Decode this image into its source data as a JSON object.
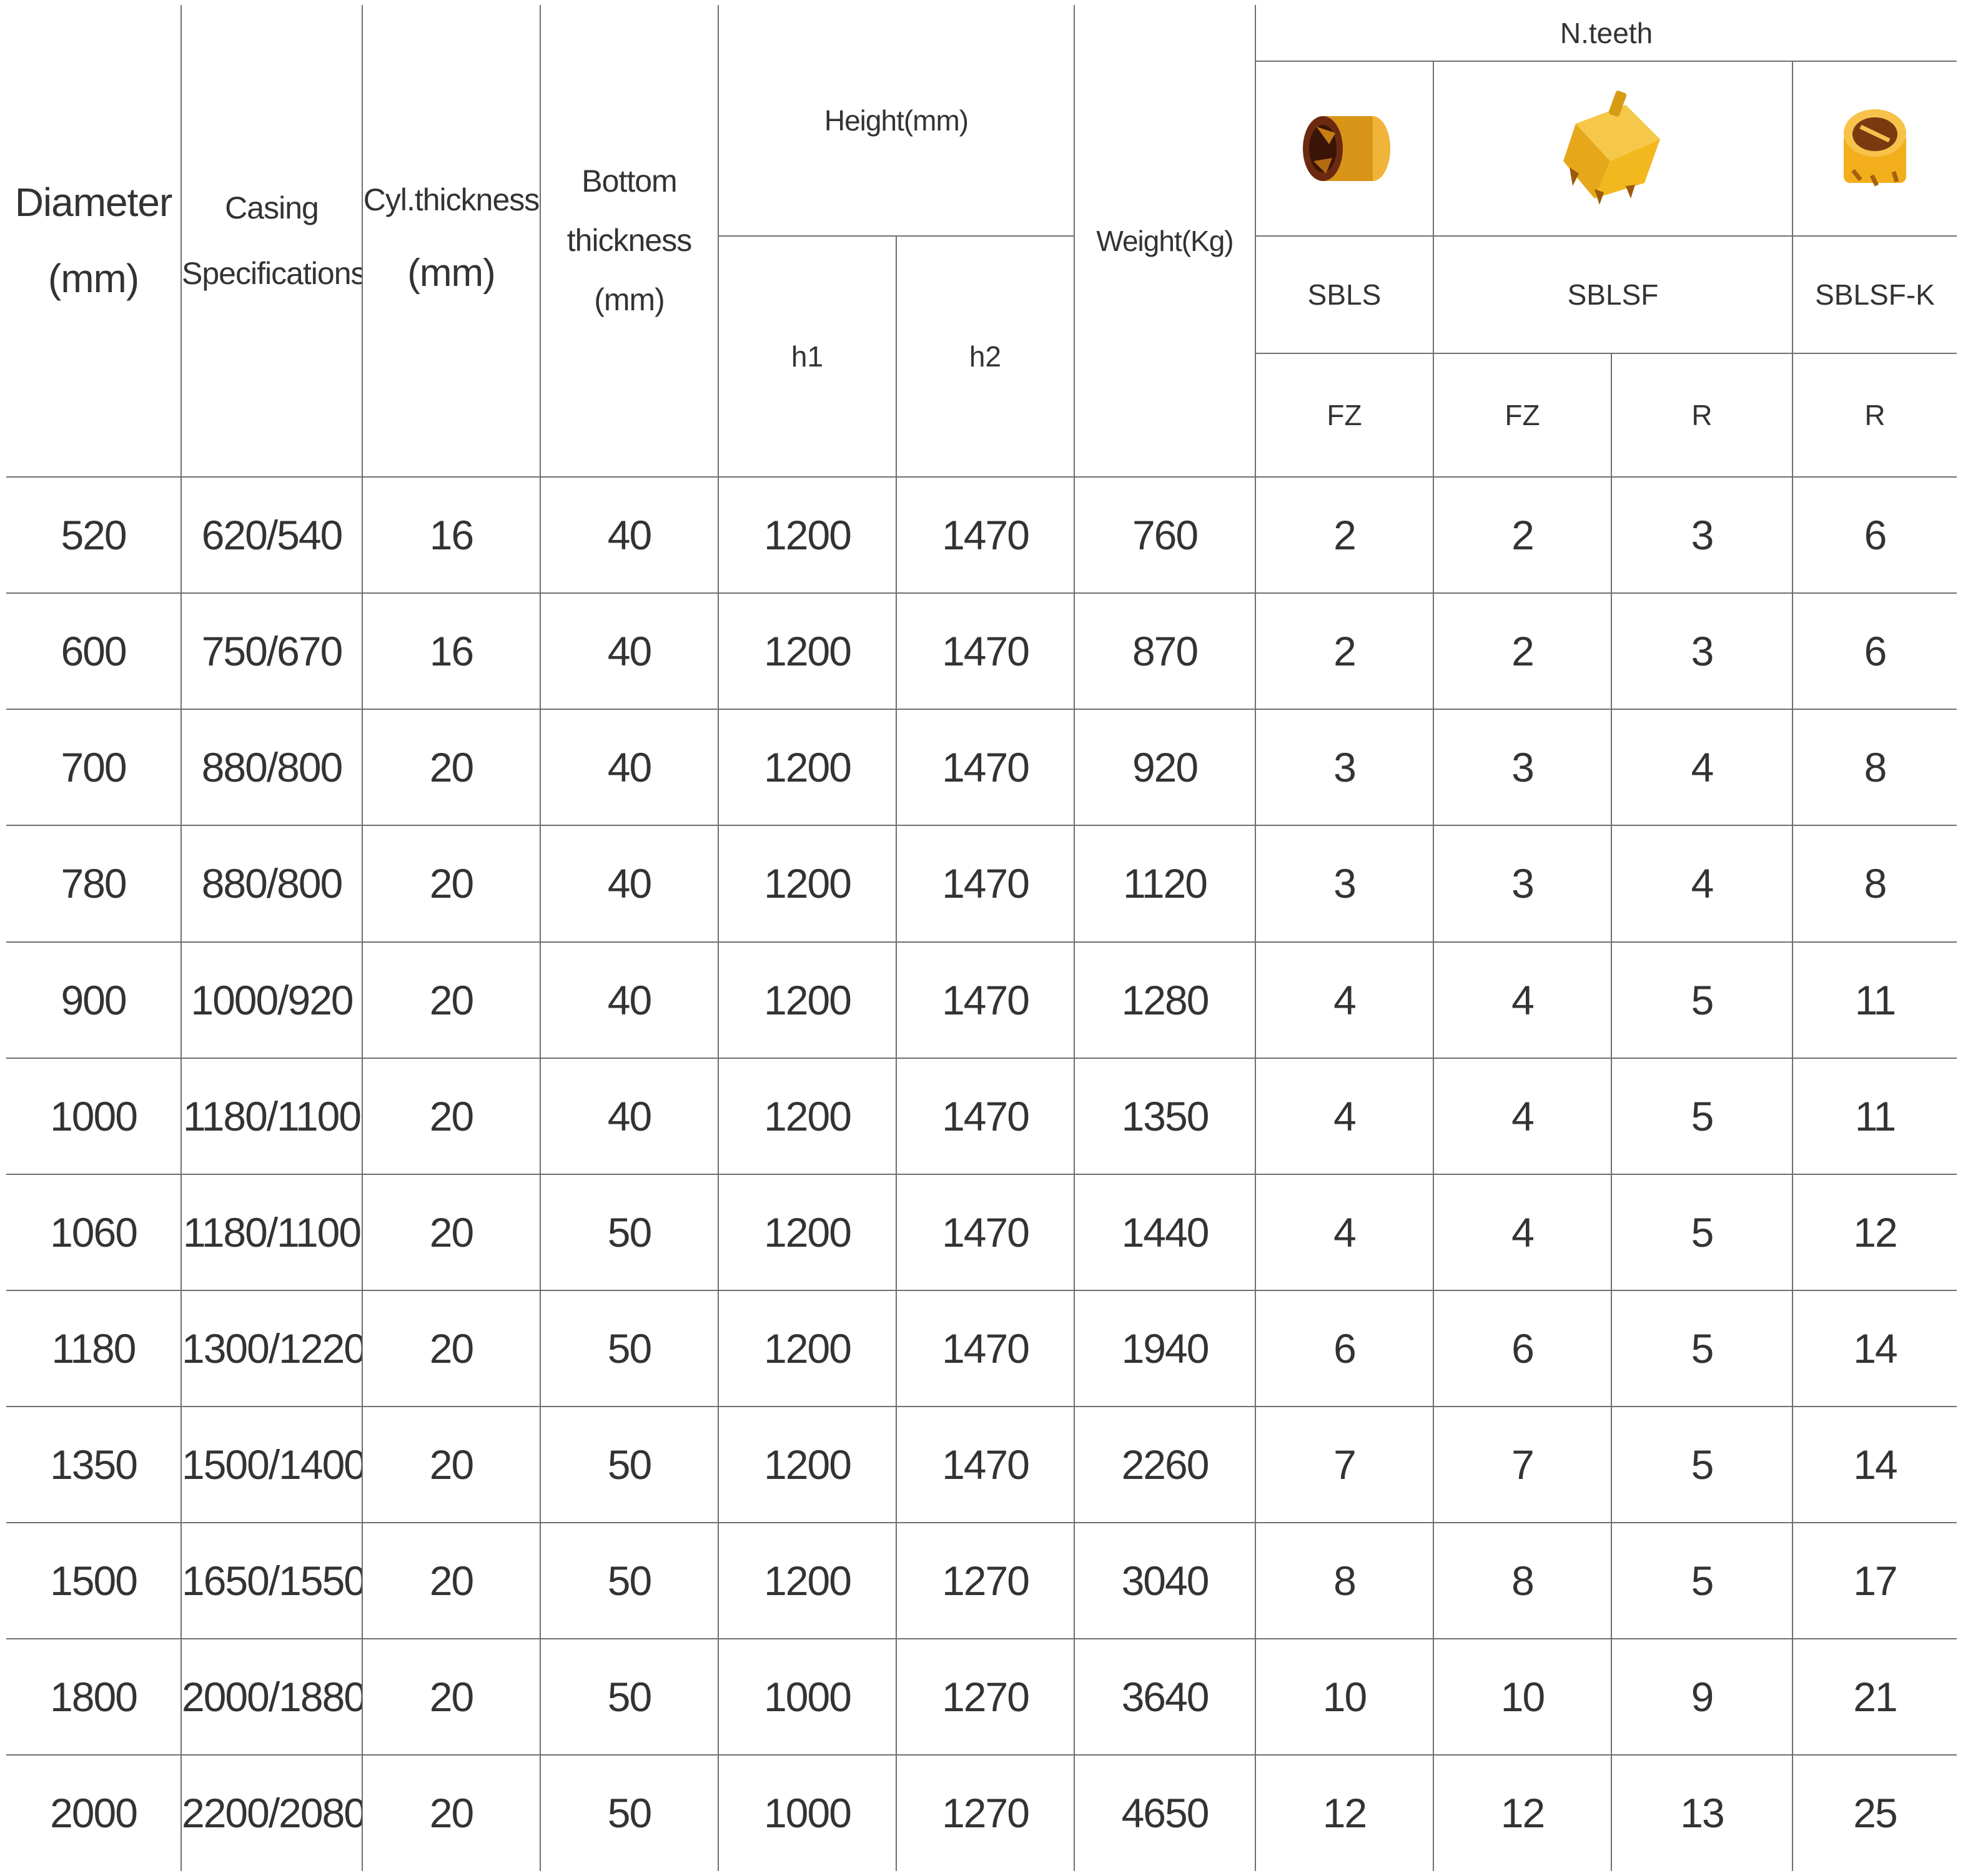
{
  "headers": {
    "diameter": [
      "Diameter",
      "(mm)"
    ],
    "casing": [
      "Casing",
      "Specifications"
    ],
    "cyl_thickness": [
      "Cyl.thickness",
      "(mm)"
    ],
    "bottom_thickness": [
      "Bottom",
      "thickness",
      "(mm)"
    ],
    "height": "Height(mm)",
    "h1": "h1",
    "h2": "h2",
    "weight": "Weight(Kg)",
    "n_teeth": "N.teeth",
    "models": [
      "SBLS",
      "SBLSF",
      "SBLSF-K"
    ],
    "teeth_types": [
      "FZ",
      "FZ",
      "R",
      "R"
    ]
  },
  "icons": [
    {
      "name": "sbls-bucket-icon",
      "color": "#e8a317"
    },
    {
      "name": "sblsf-bucket-icon",
      "color": "#f2b81e"
    },
    {
      "name": "sblsf-k-bucket-icon",
      "color": "#f5b521"
    }
  ],
  "rows": [
    [
      "520",
      "620/540",
      "16",
      "40",
      "1200",
      "1470",
      "760",
      "2",
      "2",
      "3",
      "6"
    ],
    [
      "600",
      "750/670",
      "16",
      "40",
      "1200",
      "1470",
      "870",
      "2",
      "2",
      "3",
      "6"
    ],
    [
      "700",
      "880/800",
      "20",
      "40",
      "1200",
      "1470",
      "920",
      "3",
      "3",
      "4",
      "8"
    ],
    [
      "780",
      "880/800",
      "20",
      "40",
      "1200",
      "1470",
      "1120",
      "3",
      "3",
      "4",
      "8"
    ],
    [
      "900",
      "1000/920",
      "20",
      "40",
      "1200",
      "1470",
      "1280",
      "4",
      "4",
      "5",
      "11"
    ],
    [
      "1000",
      "1180/1100",
      "20",
      "40",
      "1200",
      "1470",
      "1350",
      "4",
      "4",
      "5",
      "11"
    ],
    [
      "1060",
      "1180/1100",
      "20",
      "50",
      "1200",
      "1470",
      "1440",
      "4",
      "4",
      "5",
      "12"
    ],
    [
      "1180",
      "1300/1220",
      "20",
      "50",
      "1200",
      "1470",
      "1940",
      "6",
      "6",
      "5",
      "14"
    ],
    [
      "1350",
      "1500/1400",
      "20",
      "50",
      "1200",
      "1470",
      "2260",
      "7",
      "7",
      "5",
      "14"
    ],
    [
      "1500",
      "1650/1550",
      "20",
      "50",
      "1200",
      "1270",
      "3040",
      "8",
      "8",
      "5",
      "17"
    ],
    [
      "1800",
      "2000/1880",
      "20",
      "50",
      "1000",
      "1270",
      "3640",
      "10",
      "10",
      "9",
      "21"
    ],
    [
      "2000",
      "2200/2080",
      "20",
      "50",
      "1000",
      "1270",
      "4650",
      "12",
      "12",
      "13",
      "25"
    ]
  ]
}
